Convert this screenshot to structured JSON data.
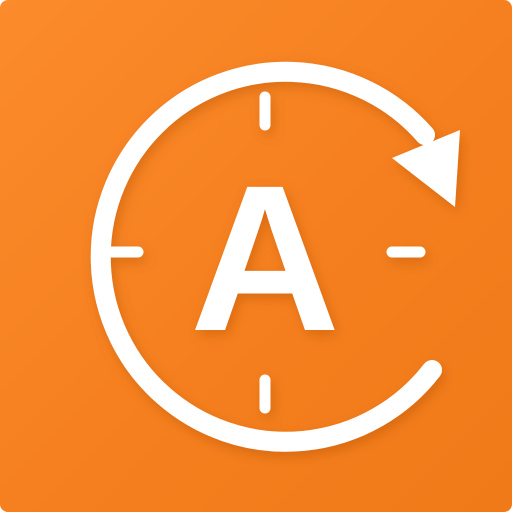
{
  "app_icon": {
    "name": "auto-rotate-timer-icon",
    "colors": {
      "background_top": "#fb8b2b",
      "background_bottom": "#f07a18",
      "foreground": "#ffffff",
      "shadow": "#b85500"
    },
    "letter": "A"
  }
}
